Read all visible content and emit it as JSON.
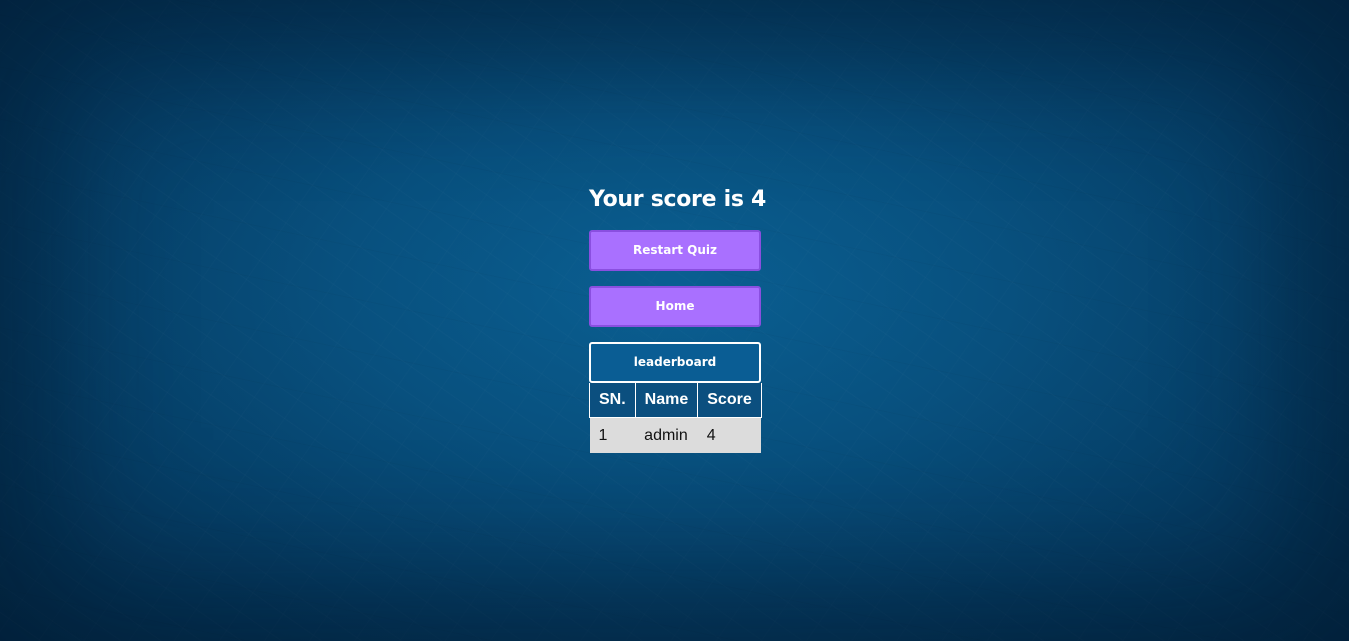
{
  "result": {
    "score_text": "Your score is 4"
  },
  "actions": {
    "restart_label": "Restart Quiz",
    "home_label": "Home"
  },
  "leaderboard": {
    "title": "leaderboard",
    "columns": [
      "SN.",
      "Name",
      "Score"
    ],
    "rows": [
      [
        "1",
        "admin",
        "4"
      ]
    ]
  },
  "colors": {
    "background": "#08507e",
    "button": "#a970ff",
    "leaderboard_header": "#0a5d94",
    "table_header": "#0b4f7f",
    "table_row": "#dcdcdc"
  }
}
